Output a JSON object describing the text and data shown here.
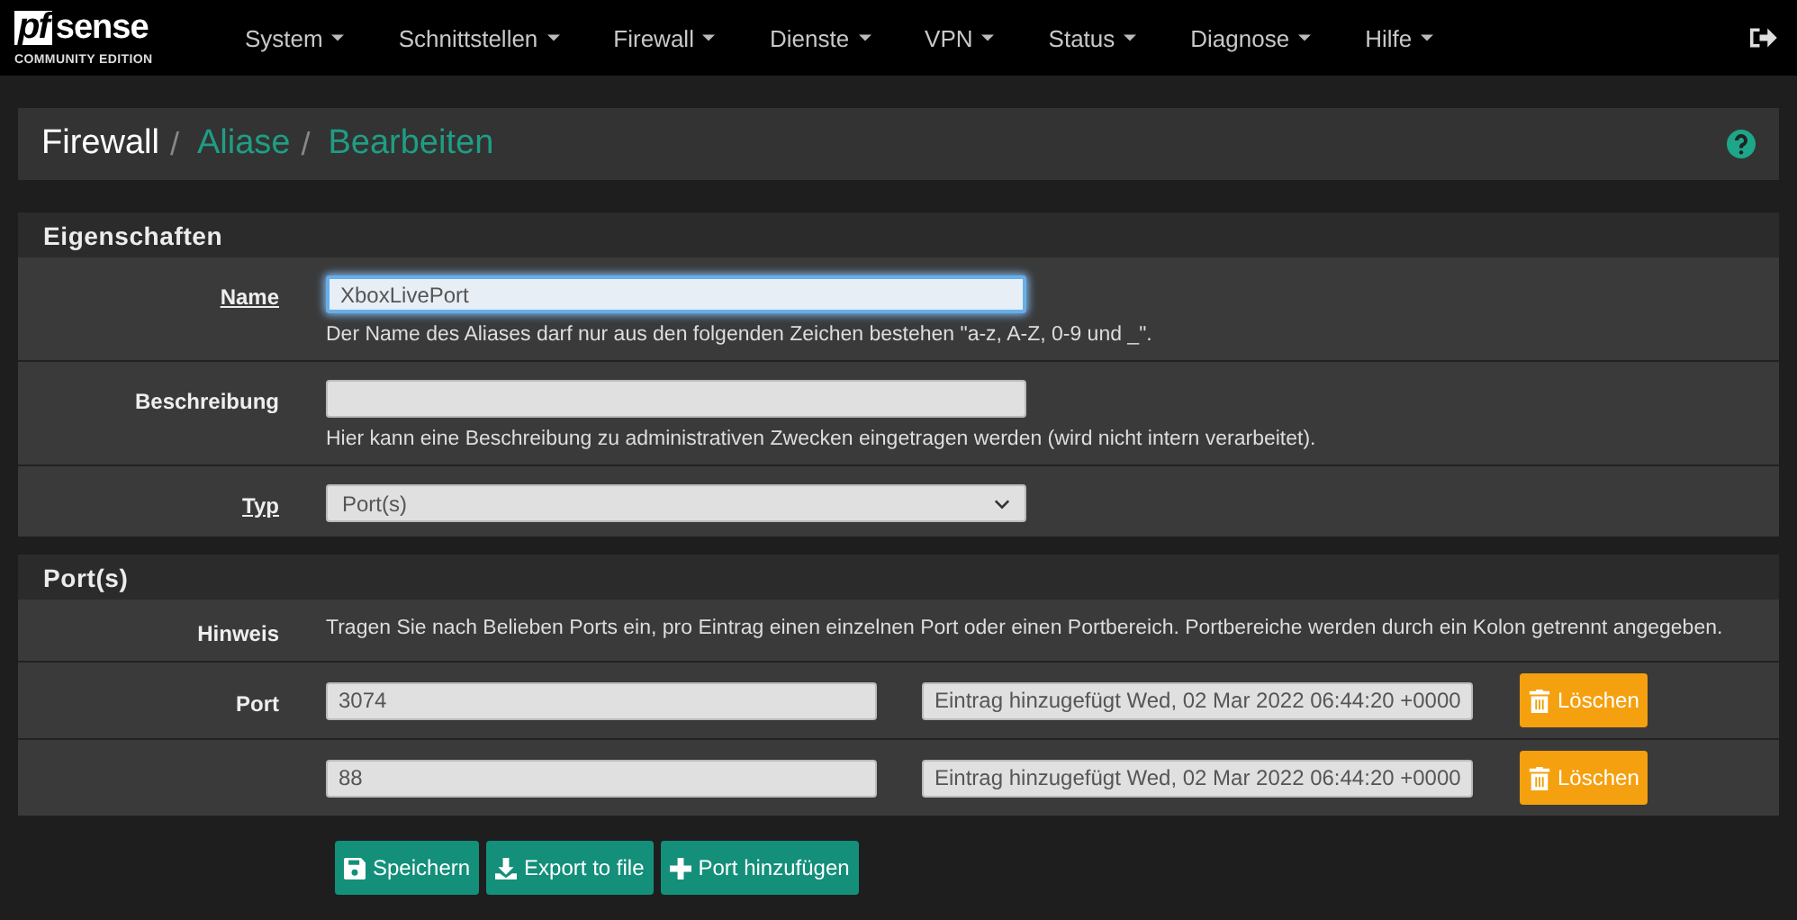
{
  "logo": {
    "mark": "pf",
    "name": "sense",
    "edition": "COMMUNITY EDITION"
  },
  "menu": [
    {
      "label": "System"
    },
    {
      "label": "Schnittstellen"
    },
    {
      "label": "Firewall"
    },
    {
      "label": "Dienste"
    },
    {
      "label": "VPN"
    },
    {
      "label": "Status"
    },
    {
      "label": "Diagnose"
    },
    {
      "label": "Hilfe"
    }
  ],
  "breadcrumb": [
    {
      "label": "Firewall",
      "link": false
    },
    {
      "separator": "/",
      "label": "Aliase",
      "link": true
    },
    {
      "separator": "/",
      "label": "Bearbeiten",
      "link": true
    }
  ],
  "properties": {
    "title": "Eigenschaften",
    "rows": [
      {
        "kind": "text",
        "label": "Name",
        "required": true,
        "value": "XboxLivePort",
        "focused": true,
        "help": "Der Name des Aliases darf nur aus den folgenden Zeichen bestehen \"a-z, A-Z, 0-9 und _\"."
      },
      {
        "kind": "text",
        "label": "Beschreibung",
        "required": false,
        "value": "",
        "focused": false,
        "help": "Hier kann eine Beschreibung zu administrativen Zwecken eingetragen werden (wird nicht intern verarbeitet)."
      },
      {
        "kind": "select",
        "label": "Typ",
        "required": true,
        "value": "Port(s)"
      }
    ]
  },
  "ports": {
    "title": "Port(s)",
    "hint_label": "Hinweis",
    "hint": "Tragen Sie nach Belieben Ports ein, pro Eintrag einen einzelnen Port oder einen Portbereich. Portbereiche werden durch ein Kolon getrennt angegeben.",
    "port_label": "Port",
    "entries": [
      {
        "port": "3074",
        "description": "Eintrag hinzugefügt Wed, 02 Mar 2022 06:44:20 +0000",
        "delete_label": "Löschen"
      },
      {
        "port": "88",
        "description": "Eintrag hinzugefügt Wed, 02 Mar 2022 06:44:20 +0000",
        "delete_label": "Löschen"
      }
    ]
  },
  "buttons": [
    {
      "kind": "save",
      "label": "Speichern"
    },
    {
      "kind": "export",
      "label": "Export to file"
    },
    {
      "kind": "add",
      "label": "Port hinzufügen"
    }
  ]
}
